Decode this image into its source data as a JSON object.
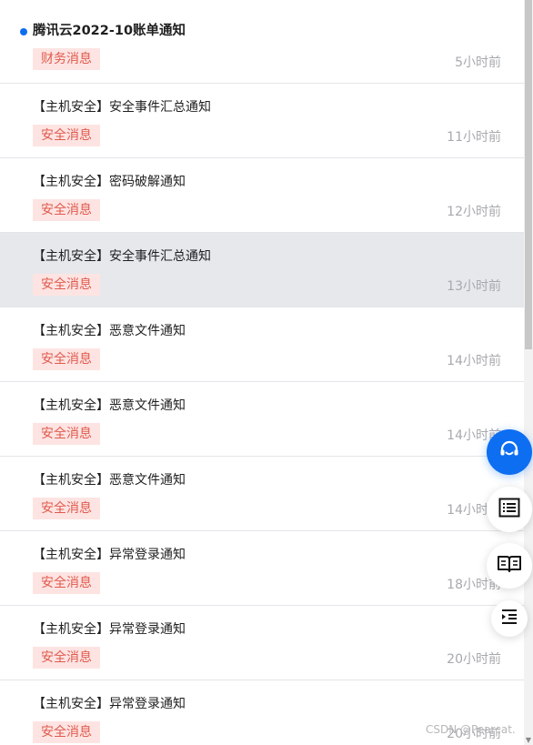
{
  "messages": [
    {
      "title": "腾讯云2022-10账单通知",
      "tag": "财务消息",
      "time": "5小时前",
      "unread": true,
      "selected": false
    },
    {
      "title": "【主机安全】安全事件汇总通知",
      "tag": "安全消息",
      "time": "11小时前",
      "unread": false,
      "selected": false
    },
    {
      "title": "【主机安全】密码破解通知",
      "tag": "安全消息",
      "time": "12小时前",
      "unread": false,
      "selected": false
    },
    {
      "title": "【主机安全】安全事件汇总通知",
      "tag": "安全消息",
      "time": "13小时前",
      "unread": false,
      "selected": true
    },
    {
      "title": "【主机安全】恶意文件通知",
      "tag": "安全消息",
      "time": "14小时前",
      "unread": false,
      "selected": false
    },
    {
      "title": "【主机安全】恶意文件通知",
      "tag": "安全消息",
      "time": "14小时前",
      "unread": false,
      "selected": false
    },
    {
      "title": "【主机安全】恶意文件通知",
      "tag": "安全消息",
      "time": "14小时前",
      "unread": false,
      "selected": false
    },
    {
      "title": "【主机安全】异常登录通知",
      "tag": "安全消息",
      "time": "18小时前",
      "unread": false,
      "selected": false
    },
    {
      "title": "【主机安全】异常登录通知",
      "tag": "安全消息",
      "time": "20小时前",
      "unread": false,
      "selected": false
    },
    {
      "title": "【主机安全】异常登录通知",
      "tag": "安全消息",
      "time": "20小时前",
      "unread": false,
      "selected": false
    }
  ],
  "floating_buttons": {
    "support_icon": "headset-icon",
    "list_icon": "list-icon",
    "docs_icon": "book-icon",
    "collapse_icon": "indent-icon"
  },
  "watermark": "CSDN @Pearcat.",
  "colors": {
    "accent": "#0d6ef2",
    "tag_bg": "#fde4e2",
    "tag_text": "#e15a4e",
    "selected_bg": "#e6e8ec"
  }
}
